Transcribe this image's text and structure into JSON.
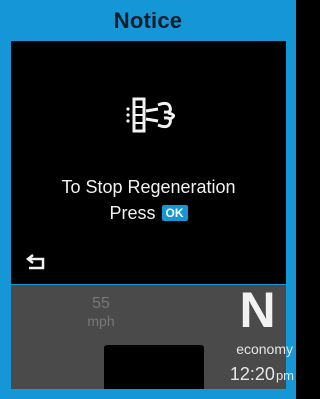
{
  "dialog": {
    "title": "Notice",
    "message": "To Stop Regeneration",
    "press_label": "Press",
    "ok_label": "OK",
    "icon": "dpf-regeneration-icon",
    "back_icon": "back-arrow-icon"
  },
  "cluster": {
    "speed_value": "55",
    "speed_unit": "mph",
    "gear": "N",
    "mode": "economy",
    "clock_time": "12:20",
    "clock_ampm": "pm"
  },
  "colors": {
    "accent": "#1596d6",
    "dialog_bg": "#000000",
    "cluster_bg": "#4a4a4a",
    "text": "#f2f2f2"
  }
}
